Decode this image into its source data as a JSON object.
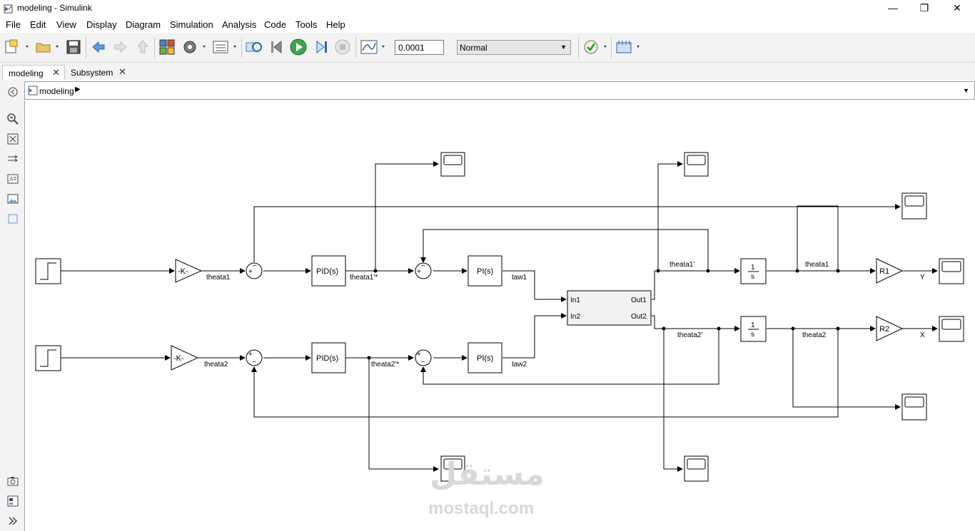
{
  "window": {
    "title": "modeling - Simulink",
    "minimize": "—",
    "restore": "❐",
    "close": "✕"
  },
  "menu": [
    "File",
    "Edit",
    "View",
    "Display",
    "Diagram",
    "Simulation",
    "Analysis",
    "Code",
    "Tools",
    "Help"
  ],
  "toolbar": {
    "stop_time": "0.0001",
    "sim_mode": "Normal"
  },
  "tabs": [
    {
      "label": "modeling",
      "active": true
    },
    {
      "label": "Subsystem",
      "active": false
    }
  ],
  "address": {
    "path": "modeling"
  },
  "blocks": {
    "gain1": "-K-",
    "gain2": "-K-",
    "pid1": "PID(s)",
    "pid2": "PID(s)",
    "pi1": "PI(s)",
    "pi2": "PI(s)",
    "subsystem_in1": "In1",
    "subsystem_in2": "In2",
    "subsystem_out1": "Out1",
    "subsystem_out2": "Out2",
    "integrator_num": "1",
    "integrator_den": "s",
    "r1": "R1",
    "r2": "R2"
  },
  "signals": {
    "theata1": "theata1",
    "theata1_ref": "theata1'*",
    "taw1": "taw1",
    "theata1_dot": "theata1'",
    "theata1_out": "theata1",
    "y": "Y",
    "theata2": "theata2",
    "theata2_ref": "theata2'*",
    "taw2": "taw2",
    "theata2_dot": "theata2'",
    "theata2_out": "theata2",
    "x": "X"
  },
  "sum_signs": {
    "plus": "+",
    "minus": "−"
  },
  "watermark": {
    "arabic": "مستقل",
    "latin": "mostaql.com"
  },
  "colors": {
    "run_green": "#2e9e2e",
    "nav_blue": "#1f6fd1",
    "canvas_bg": "#ffffff",
    "toolbar_bg": "#f3f3f3"
  }
}
